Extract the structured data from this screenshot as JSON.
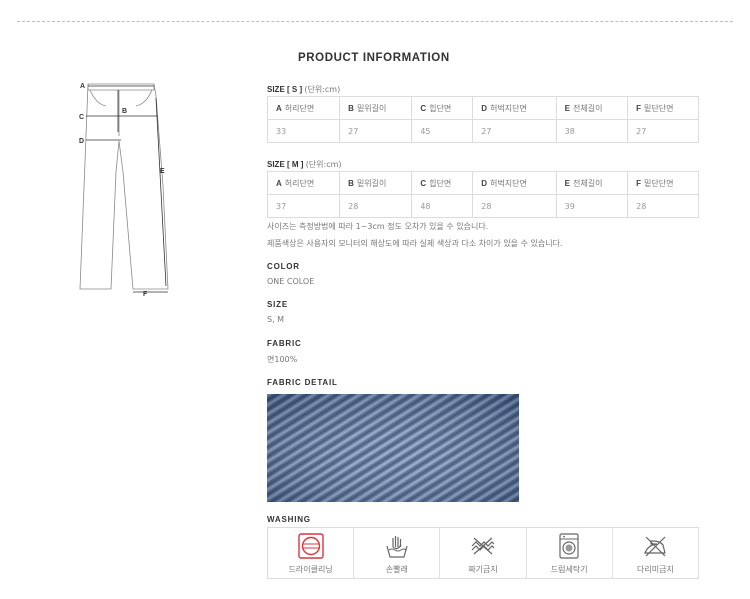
{
  "title": "PRODUCT INFORMATION",
  "diagram": {
    "labels": [
      "A",
      "B",
      "C",
      "D",
      "E",
      "F"
    ]
  },
  "size_tables": [
    {
      "label": "SIZE [ S ]",
      "unit": "(단위:cm)",
      "headers": [
        {
          "letter": "A",
          "name": "허리단면"
        },
        {
          "letter": "B",
          "name": "밑위길이"
        },
        {
          "letter": "C",
          "name": "힙단면"
        },
        {
          "letter": "D",
          "name": "허벅지단면"
        },
        {
          "letter": "E",
          "name": "전체길이"
        },
        {
          "letter": "F",
          "name": "밑단단면"
        }
      ],
      "values": [
        "33",
        "27",
        "45",
        "27",
        "38",
        "27"
      ]
    },
    {
      "label": "SIZE [ M ]",
      "unit": "(단위:cm)",
      "headers": [
        {
          "letter": "A",
          "name": "허리단면"
        },
        {
          "letter": "B",
          "name": "밑위길이"
        },
        {
          "letter": "C",
          "name": "힙단면"
        },
        {
          "letter": "D",
          "name": "허벅지단면"
        },
        {
          "letter": "E",
          "name": "전체길이"
        },
        {
          "letter": "F",
          "name": "밑단단면"
        }
      ],
      "values": [
        "37",
        "28",
        "48",
        "28",
        "39",
        "28"
      ]
    }
  ],
  "notes": [
    "사이즈는 측정방법에 따라 1~3cm 정도 오차가 있을 수 있습니다.",
    "제품색상은 사용자의 모니터의 해상도에 따라 실제 색상과 다소 차이가 있을 수 있습니다."
  ],
  "color": {
    "title": "COLOR",
    "value": "ONE COLOE"
  },
  "size": {
    "title": "SIZE",
    "value": "S, M"
  },
  "fabric": {
    "title": "FABRIC",
    "value": "면100%"
  },
  "fabric_detail": {
    "title": "FABRIC DETAIL",
    "swatch_color": "#4f6a93"
  },
  "washing": {
    "title": "WASHING",
    "accent": "#d9363e",
    "items": [
      {
        "label": "드라이클리닝",
        "icon": "dry-cleaning-icon",
        "active": true
      },
      {
        "label": "손빨래",
        "icon": "hand-wash-icon",
        "active": false
      },
      {
        "label": "짜기금지",
        "icon": "no-wring-icon",
        "active": false
      },
      {
        "label": "드럼세탁기",
        "icon": "drum-washer-icon",
        "active": false
      },
      {
        "label": "다리미금지",
        "icon": "no-iron-icon",
        "active": false
      }
    ]
  }
}
